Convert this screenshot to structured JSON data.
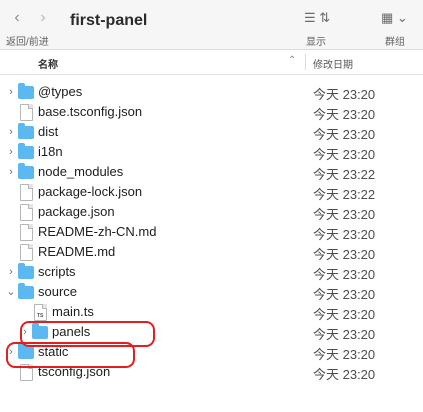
{
  "toolbar": {
    "title": "first-panel",
    "nav_label": "返回/前进",
    "view_label": "显示",
    "group_label": "群组"
  },
  "columns": {
    "name": "名称",
    "date": "修改日期"
  },
  "rows": [
    {
      "label": "@types",
      "type": "folder",
      "indent": 0,
      "chevron": "collapsed",
      "date": "今天 23:20"
    },
    {
      "label": "base.tsconfig.json",
      "type": "file",
      "indent": 0,
      "chevron": "",
      "date": "今天 23:20"
    },
    {
      "label": "dist",
      "type": "folder",
      "indent": 0,
      "chevron": "collapsed",
      "date": "今天 23:20"
    },
    {
      "label": "i18n",
      "type": "folder",
      "indent": 0,
      "chevron": "collapsed",
      "date": "今天 23:20"
    },
    {
      "label": "node_modules",
      "type": "folder",
      "indent": 0,
      "chevron": "collapsed",
      "date": "今天 23:22"
    },
    {
      "label": "package-lock.json",
      "type": "file",
      "indent": 0,
      "chevron": "",
      "date": "今天 23:22"
    },
    {
      "label": "package.json",
      "type": "file",
      "indent": 0,
      "chevron": "",
      "date": "今天 23:20"
    },
    {
      "label": "README-zh-CN.md",
      "type": "file",
      "indent": 0,
      "chevron": "",
      "date": "今天 23:20"
    },
    {
      "label": "README.md",
      "type": "file",
      "indent": 0,
      "chevron": "",
      "date": "今天 23:20"
    },
    {
      "label": "scripts",
      "type": "folder",
      "indent": 0,
      "chevron": "collapsed",
      "date": "今天 23:20"
    },
    {
      "label": "source",
      "type": "folder",
      "indent": 0,
      "chevron": "expanded",
      "date": "今天 23:20"
    },
    {
      "label": "main.ts",
      "type": "ts-file",
      "indent": 1,
      "chevron": "",
      "date": "今天 23:20"
    },
    {
      "label": "panels",
      "type": "folder",
      "indent": 1,
      "chevron": "collapsed",
      "date": "今天 23:20"
    },
    {
      "label": "static",
      "type": "folder",
      "indent": 0,
      "chevron": "collapsed",
      "date": "今天 23:20"
    },
    {
      "label": "tsconfig.json",
      "type": "file",
      "indent": 0,
      "chevron": "",
      "date": "今天 23:20"
    }
  ],
  "annotations": {
    "color": "#e02020"
  },
  "colors": {
    "folder": "#5bb8f0"
  }
}
